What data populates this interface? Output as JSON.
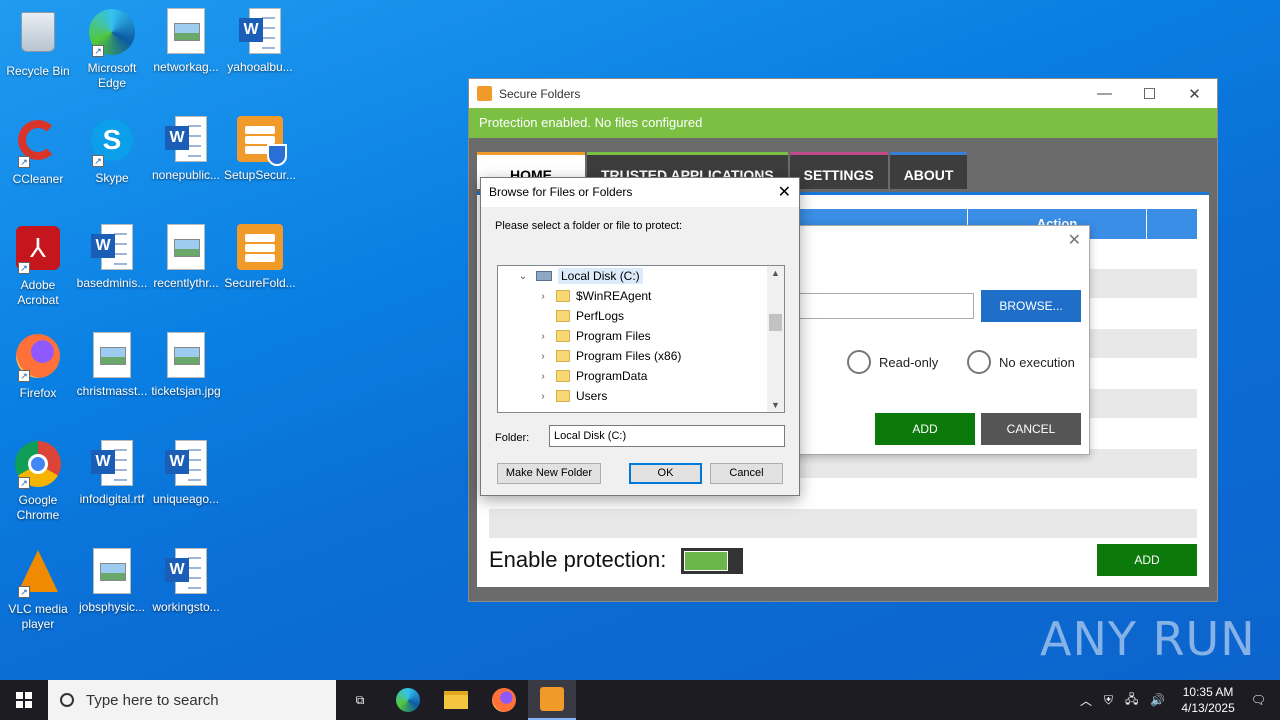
{
  "desktop": {
    "icons": [
      {
        "label": "Recycle Bin",
        "icon": "recycle-bin-icon"
      },
      {
        "label": "Microsoft Edge",
        "icon": "edge-icon"
      },
      {
        "label": "networkag...",
        "icon": "image-file-icon"
      },
      {
        "label": "yahooalbu...",
        "icon": "word-doc-icon"
      },
      {
        "label": "CCleaner",
        "icon": "ccleaner-icon"
      },
      {
        "label": "Skype",
        "icon": "skype-icon"
      },
      {
        "label": "nonepublic...",
        "icon": "word-doc-icon"
      },
      {
        "label": "SetupSecur...",
        "icon": "setup-icon"
      },
      {
        "label": "Adobe Acrobat",
        "icon": "acrobat-icon"
      },
      {
        "label": "basedminis...",
        "icon": "word-doc-icon"
      },
      {
        "label": "recentlythr...",
        "icon": "image-file-icon"
      },
      {
        "label": "SecureFold...",
        "icon": "securefolders-icon"
      },
      {
        "label": "Firefox",
        "icon": "firefox-icon"
      },
      {
        "label": "christmasst...",
        "icon": "image-file-icon"
      },
      {
        "label": "ticketsjan.jpg",
        "icon": "image-file-icon"
      },
      {
        "label": "Google Chrome",
        "icon": "chrome-icon"
      },
      {
        "label": "infodigital.rtf",
        "icon": "word-doc-icon"
      },
      {
        "label": "uniqueago...",
        "icon": "word-doc-icon"
      },
      {
        "label": "VLC media player",
        "icon": "vlc-icon"
      },
      {
        "label": "jobsphysic...",
        "icon": "image-file-icon"
      },
      {
        "label": "workingsto...",
        "icon": "word-doc-icon"
      }
    ]
  },
  "main_window": {
    "title": "Secure Folders",
    "banner": "Protection enabled. No files configured",
    "banner_color": "#7bc043",
    "tabs": [
      "HOME",
      "TRUSTED APPLICATIONS",
      "SETTINGS",
      "ABOUT"
    ],
    "table_action_header": "Action",
    "enable_label": "Enable protection:",
    "add_label": "ADD"
  },
  "add_dialog": {
    "browse_label": "BROWSE...",
    "radio_readonly": "Read-only",
    "radio_noexec": "No execution",
    "add_label": "ADD",
    "cancel_label": "CANCEL"
  },
  "browse_dialog": {
    "title": "Browse for Files or Folders",
    "prompt": "Please select a folder or file to protect:",
    "tree": [
      {
        "label": "Local Disk (C:)",
        "level": 0,
        "expanded": true,
        "selected": true,
        "type": "drive"
      },
      {
        "label": "$WinREAgent",
        "level": 1,
        "expandable": true,
        "type": "folder"
      },
      {
        "label": "PerfLogs",
        "level": 1,
        "expandable": false,
        "type": "folder"
      },
      {
        "label": "Program Files",
        "level": 1,
        "expandable": true,
        "type": "folder"
      },
      {
        "label": "Program Files (x86)",
        "level": 1,
        "expandable": true,
        "type": "folder"
      },
      {
        "label": "ProgramData",
        "level": 1,
        "expandable": true,
        "type": "folder"
      },
      {
        "label": "Users",
        "level": 1,
        "expandable": true,
        "type": "folder"
      }
    ],
    "folder_label": "Folder:",
    "folder_value": "Local Disk (C:)",
    "make_new_folder": "Make New Folder",
    "ok": "OK",
    "cancel": "Cancel"
  },
  "watermark": "ANY RUN",
  "taskbar": {
    "search_placeholder": "Type here to search",
    "time": "10:35 AM",
    "date": "4/13/2025"
  }
}
